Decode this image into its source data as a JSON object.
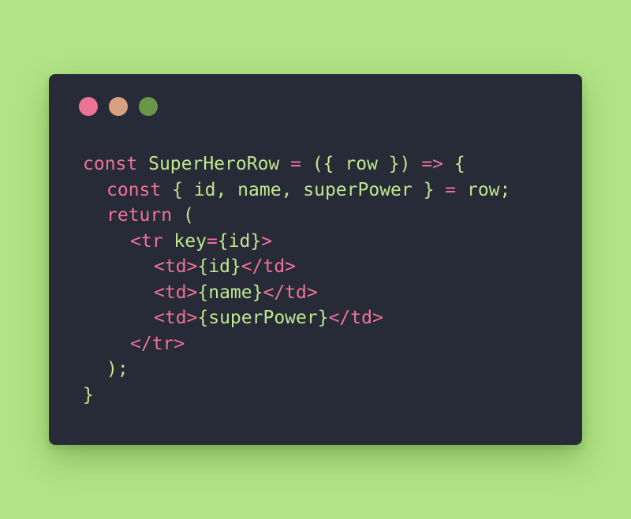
{
  "colors": {
    "background": "#b1e484",
    "window": "#272a37",
    "close_dot": "#ec7395",
    "minimize_dot": "#d8a07e",
    "maximize_dot": "#6a9747",
    "keyword": "#f0729a",
    "identifier": "#bfe78e",
    "operator": "#f0729a",
    "punctuation": "#e8e8e8",
    "tag": "#f0729a"
  },
  "window_controls": [
    "close",
    "minimize",
    "maximize"
  ],
  "code_lines": [
    {
      "indent": 0,
      "tokens": [
        {
          "t": "const",
          "k": "keyword"
        },
        {
          "t": " SuperHeroRow ",
          "k": "identifier"
        },
        {
          "t": "=",
          "k": "operator"
        },
        {
          "t": " ({ ",
          "k": "identifier"
        },
        {
          "t": "row",
          "k": "identifier"
        },
        {
          "t": " }) ",
          "k": "identifier"
        },
        {
          "t": "=>",
          "k": "operator"
        },
        {
          "t": " {",
          "k": "identifier"
        }
      ]
    },
    {
      "indent": 1,
      "tokens": [
        {
          "t": "const",
          "k": "keyword"
        },
        {
          "t": " { id, name, superPower } ",
          "k": "identifier"
        },
        {
          "t": "=",
          "k": "operator"
        },
        {
          "t": " row;",
          "k": "identifier"
        }
      ]
    },
    {
      "indent": 1,
      "tokens": [
        {
          "t": "return",
          "k": "keyword"
        },
        {
          "t": " (",
          "k": "identifier"
        }
      ]
    },
    {
      "indent": 2,
      "tokens": [
        {
          "t": "<tr",
          "k": "tag"
        },
        {
          "t": " key",
          "k": "identifier"
        },
        {
          "t": "=",
          "k": "operator"
        },
        {
          "t": "{id}",
          "k": "identifier"
        },
        {
          "t": ">",
          "k": "tag"
        }
      ]
    },
    {
      "indent": 3,
      "tokens": [
        {
          "t": "<td>",
          "k": "tag"
        },
        {
          "t": "{id}",
          "k": "identifier"
        },
        {
          "t": "</td>",
          "k": "tag"
        }
      ]
    },
    {
      "indent": 3,
      "tokens": [
        {
          "t": "<td>",
          "k": "tag"
        },
        {
          "t": "{name}",
          "k": "identifier"
        },
        {
          "t": "</td>",
          "k": "tag"
        }
      ]
    },
    {
      "indent": 3,
      "tokens": [
        {
          "t": "<td>",
          "k": "tag"
        },
        {
          "t": "{superPower}",
          "k": "identifier"
        },
        {
          "t": "</td>",
          "k": "tag"
        }
      ]
    },
    {
      "indent": 2,
      "tokens": [
        {
          "t": "</tr>",
          "k": "tag"
        }
      ]
    },
    {
      "indent": 1,
      "tokens": [
        {
          "t": ");",
          "k": "identifier"
        }
      ]
    },
    {
      "indent": 0,
      "tokens": [
        {
          "t": "}",
          "k": "identifier"
        }
      ]
    }
  ]
}
